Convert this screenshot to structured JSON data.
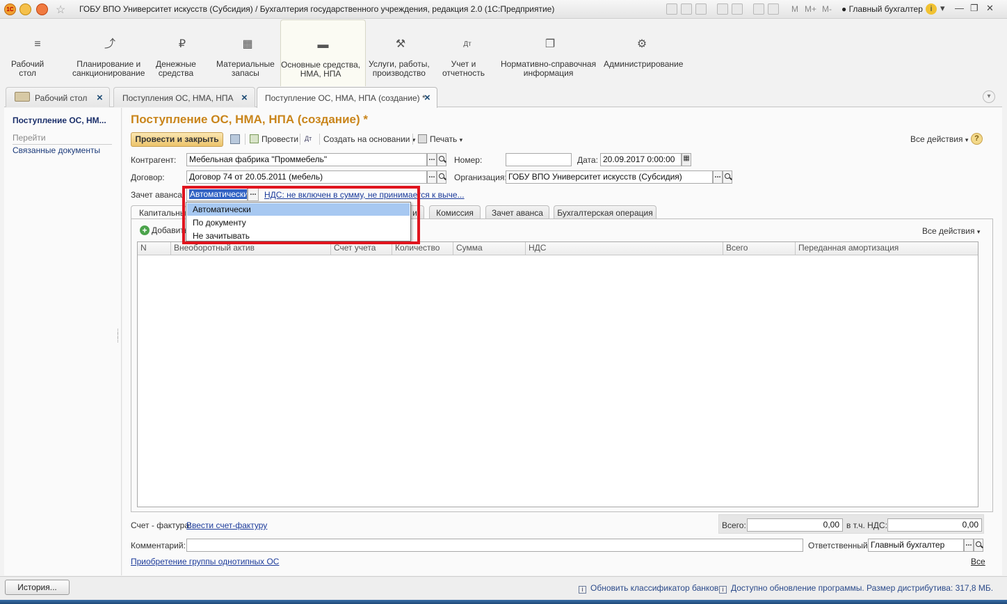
{
  "window": {
    "title": "ГОБУ ВПО Университет искусств (Субсидия) / Бухгалтерия государственного учреждения, редакция 2.0  (1С:Предприятие)",
    "m_labels": [
      "M",
      "M+",
      "M-"
    ],
    "user": "Главный бухгалтер",
    "app_logo": "1С"
  },
  "sections": [
    {
      "label": "Рабочий\nстол",
      "icon": "menu-icon"
    },
    {
      "label": "Планирование и\nсанкционирование",
      "icon": "planning-icon"
    },
    {
      "label": "Денежные\nсредства",
      "icon": "ruble-icon"
    },
    {
      "label": "Материальные\nзапасы",
      "icon": "grid-icon"
    },
    {
      "label": "Основные средства,\nНМА, НПА",
      "icon": "truck-icon"
    },
    {
      "label": "Услуги, работы,\nпроизводство",
      "icon": "tools-icon"
    },
    {
      "label": "Учет и\nотчетность",
      "icon": "dt-kt-icon"
    },
    {
      "label": "Нормативно-справочная\nинформация",
      "icon": "docs-icon"
    },
    {
      "label": "Администрирование",
      "icon": "gear-icon"
    }
  ],
  "open_tabs": [
    {
      "label": "Рабочий стол"
    },
    {
      "label": "Поступления ОС, НМА, НПА"
    },
    {
      "label": "Поступление ОС, НМА, НПА (создание) *"
    }
  ],
  "leftnav": {
    "current": "Поступление ОС, НМ...",
    "heading": "Перейти",
    "link": "Связанные документы"
  },
  "form": {
    "title": "Поступление ОС, НМА, НПА (создание) *",
    "toolbar": {
      "post_close": "Провести и закрыть",
      "post": "Провести",
      "create_basis": "Создать на основании",
      "print": "Печать",
      "all_actions": "Все действия",
      "help": "?"
    },
    "counterparty_label": "Контрагент:",
    "counterparty_value": "Мебельная фабрика \"Проммебель\"",
    "number_label": "Номер:",
    "number_value": "",
    "date_label": "Дата:",
    "date_value": "20.09.2017  0:00:00",
    "contract_label": "Договор:",
    "contract_value": "Договор 74 от 20.05.2011 (мебель)",
    "org_label": "Организация:",
    "org_value": "ГОБУ ВПО Университет искусств (Субсидия)",
    "advance_label": "Зачет аванса:",
    "advance_value": "Автоматически",
    "vat_link": "НДС: не включен в сумму, не принимается к выче...",
    "inner_tabs": [
      "Капитальные",
      "и",
      "Комиссия",
      "Зачет аванса",
      "Бухгалтерская операция"
    ],
    "add_button": "Добавить",
    "panel_all_actions": "Все действия",
    "columns": [
      "N",
      "Внеоборотный актив",
      "Счет учета",
      "Количество",
      "Сумма",
      "НДС",
      "Всего",
      "Переданная амортизация"
    ],
    "invoice_label": "Счет - фактура:",
    "invoice_link": "Ввести счет-фактуру",
    "total_label": "Всего:",
    "total_value": "0,00",
    "vat_total_label": "в т.ч. НДС:",
    "vat_total_value": "0,00",
    "comment_label": "Комментарий:",
    "comment_value": "",
    "responsible_label": "Ответственный:",
    "responsible_value": "Главный бухгалтер",
    "group_link": "Приобретение группы однотипных ОС",
    "all_link": "Все"
  },
  "dropdown": {
    "options": [
      "Автоматически",
      "По документу",
      "Не зачитывать"
    ],
    "selected": "Автоматически"
  },
  "statusbar": {
    "history": "История...",
    "msg1": "Обновить классификатор банков",
    "msg2": "Доступно обновление программы. Размер дистрибутива: 317,8 МБ."
  },
  "colors": {
    "title_accent": "#c9851b",
    "link": "#1b3a9a",
    "highlight_box": "#e0141e",
    "dropdown_selected": "#a7c8f1"
  }
}
